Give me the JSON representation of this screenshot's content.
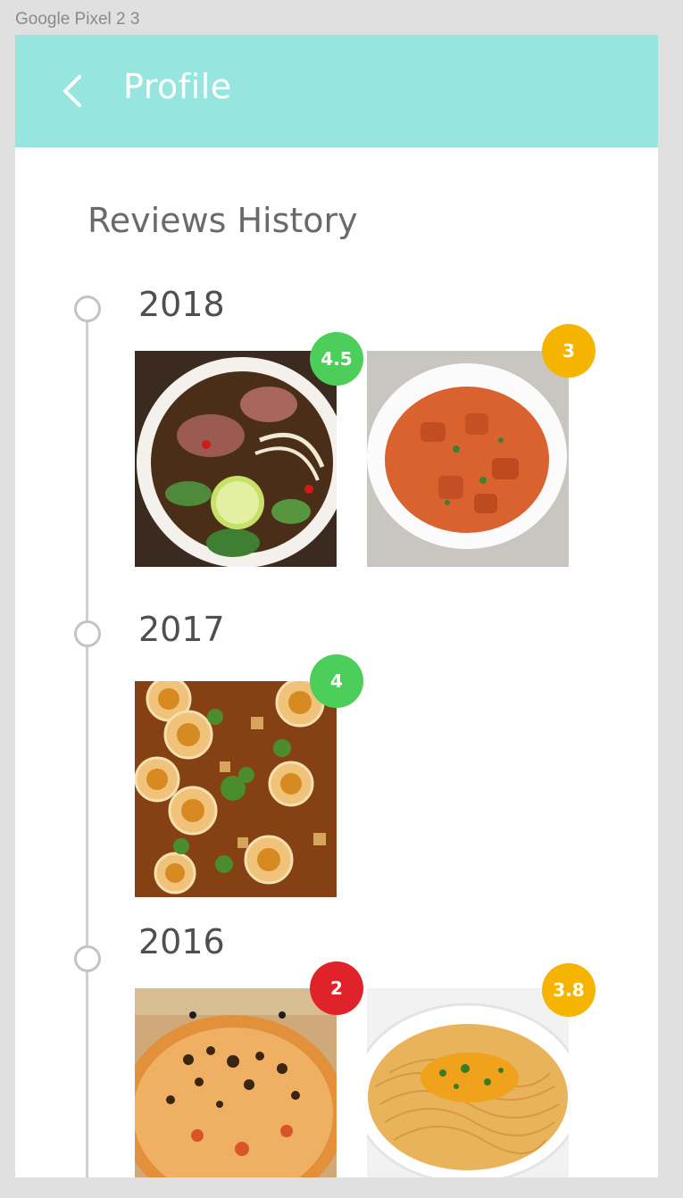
{
  "device": {
    "label": "Google Pixel 2 3"
  },
  "appbar": {
    "title": "Profile",
    "color": "#97e5df",
    "back_icon": "chevron-left-icon"
  },
  "section": {
    "title": "Reviews History"
  },
  "timeline": [
    {
      "year": "2018",
      "reviews": [
        {
          "dish": "pho soup",
          "rating": "4.5",
          "badge_color": "#4cce5a"
        },
        {
          "dish": "chicken curry",
          "rating": "3",
          "badge_color": "#f5b400"
        }
      ]
    },
    {
      "year": "2017",
      "reviews": [
        {
          "dish": "egg curry",
          "rating": "4",
          "badge_color": "#4cce5a"
        }
      ]
    },
    {
      "year": "2016",
      "reviews": [
        {
          "dish": "burnt pizza",
          "rating": "2",
          "badge_color": "#e0232a"
        },
        {
          "dish": "spaghetti",
          "rating": "3.8",
          "badge_color": "#f5b400"
        }
      ]
    }
  ]
}
